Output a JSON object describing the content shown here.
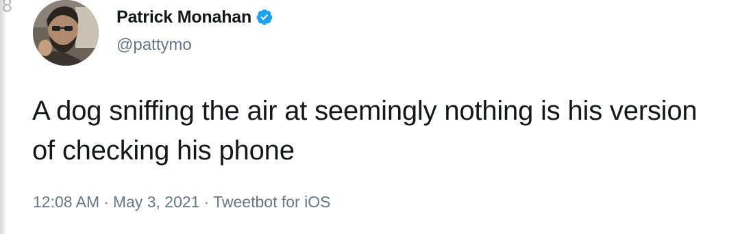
{
  "tweet": {
    "display_name": "Patrick Monahan",
    "handle": "@pattymo",
    "text": "A dog sniffing the air at seemingly nothing is his version of checking his phone",
    "time": "12:08 AM",
    "separator": "·",
    "date": "May 3, 2021",
    "source": "Tweetbot for iOS",
    "verified": true
  },
  "colors": {
    "verified_badge": "#1da1f2",
    "text": "#14171a",
    "muted": "#657786"
  },
  "icons": {
    "verified": "verified-badge-icon",
    "avatar": "profile-photo"
  }
}
